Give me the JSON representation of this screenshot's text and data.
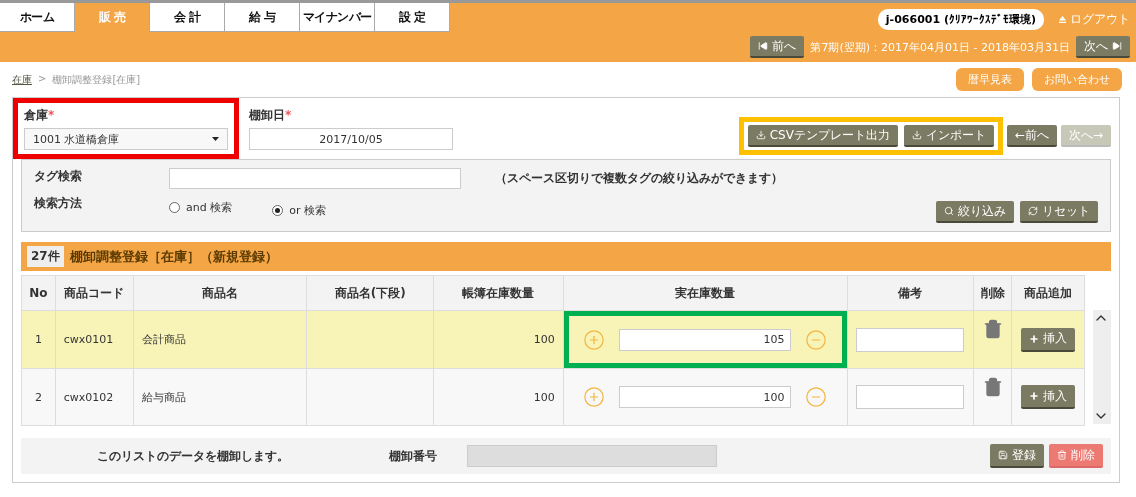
{
  "top_tabs": [
    {
      "label": "ホーム",
      "selected": false
    },
    {
      "label": "販 売",
      "selected": true
    },
    {
      "label": "会 計",
      "selected": false
    },
    {
      "label": "給 与",
      "selected": false
    },
    {
      "label": "マイナンバー",
      "selected": false
    },
    {
      "label": "設 定",
      "selected": false
    }
  ],
  "user_badge": "j-066001 (ｸﾘｱﾜｰｸｽﾃﾞﾓ環境)",
  "logout": "ログアウト",
  "period": {
    "prev": "前へ",
    "label": "第7期(翌期)：2017年04月01日 - 2018年03月31日",
    "next": "次へ"
  },
  "breadcrumb": {
    "parent": "在庫",
    "separator": ">",
    "current": "棚卸調整登録[在庫]"
  },
  "header_buttons": [
    "暦早見表",
    "お問い合わせ"
  ],
  "warehouse": {
    "label": "倉庫",
    "required_mark": "*",
    "value": "1001 水道橋倉庫",
    "highlighted": true
  },
  "date": {
    "label": "棚卸日",
    "required_mark": "*",
    "value": "2017/10/05"
  },
  "toolbar": {
    "highlighted": true,
    "buttons": [
      "CSVテンプレート出力",
      "インポート"
    ]
  },
  "nav_buttons": [
    {
      "label": "←前へ",
      "disabled": false
    },
    {
      "label": "次へ→",
      "disabled": true
    }
  ],
  "tag_search": {
    "label": "タグ検索",
    "hint": "（スペース区切りで複数タグの絞り込みができます）"
  },
  "search_method": {
    "label": "検索方法",
    "options": [
      {
        "label": "and 検索",
        "selected": false
      },
      {
        "label": "or 検索",
        "selected": true
      }
    ]
  },
  "filter_buttons": [
    {
      "kind": "filter",
      "label": "絞り込み"
    },
    {
      "kind": "reset",
      "label": "リセット"
    }
  ],
  "list": {
    "count": "27件",
    "title": "棚卸調整登録［在庫］（新規登録）"
  },
  "table": {
    "columns": [
      "No",
      "商品コード",
      "商品名",
      "商品名(下段)",
      "帳簿在庫数量",
      "実在庫数量",
      "備考",
      "削除",
      "商品追加"
    ],
    "rows": [
      {
        "no": "1",
        "code": "cwx0101",
        "name": "会計商品",
        "book": "100",
        "actual": "105",
        "selected": true,
        "highlighted": true,
        "insert": "挿入"
      },
      {
        "no": "2",
        "code": "cwx0102",
        "name": "給与商品",
        "book": "100",
        "actual": "100",
        "selected": false,
        "highlighted": false,
        "insert": "挿入"
      }
    ]
  },
  "footer": {
    "message": "このリストのデータを棚卸します。",
    "number_label": "棚卸番号",
    "buttons": [
      {
        "kind": "save",
        "label": "登録"
      },
      {
        "kind": "delete",
        "label": "削除"
      }
    ]
  }
}
